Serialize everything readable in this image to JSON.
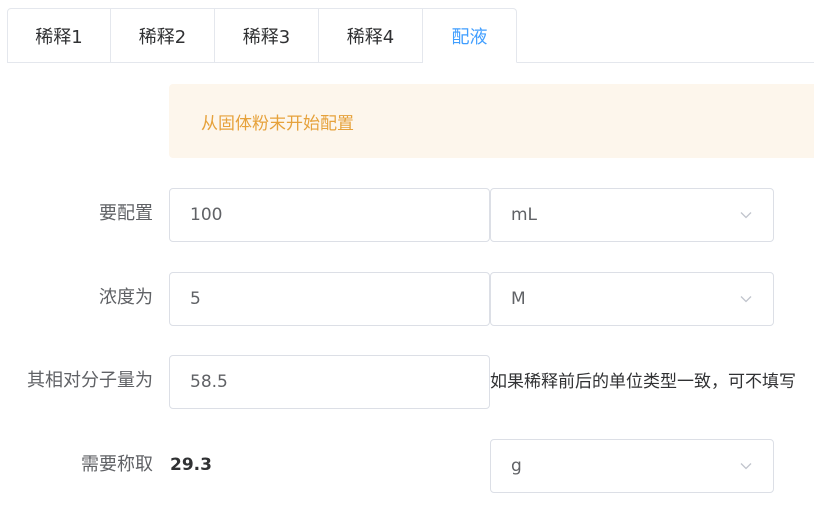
{
  "tabs": [
    {
      "label": "稀释1",
      "active": false
    },
    {
      "label": "稀释2",
      "active": false
    },
    {
      "label": "稀释3",
      "active": false
    },
    {
      "label": "稀释4",
      "active": false
    },
    {
      "label": "配液",
      "active": true
    }
  ],
  "alert": {
    "text": "从固体粉末开始配置"
  },
  "form": {
    "volume": {
      "label": "要配置",
      "value": "100",
      "unit": "mL"
    },
    "concentration": {
      "label": "浓度为",
      "value": "5",
      "unit": "M"
    },
    "molar_mass": {
      "label": "其相对分子量为",
      "value": "58.5",
      "hint": "如果稀释前后的单位类型一致，可不填写"
    },
    "required": {
      "label": "需要称取",
      "value": "29.3",
      "unit": "g"
    }
  },
  "colors": {
    "active_tab": "#409eff",
    "alert_bg": "#fdf6ec",
    "alert_text": "#e6a23c",
    "border": "#dcdfe6"
  },
  "icons": {
    "select_arrow": "chevron-down-icon"
  }
}
